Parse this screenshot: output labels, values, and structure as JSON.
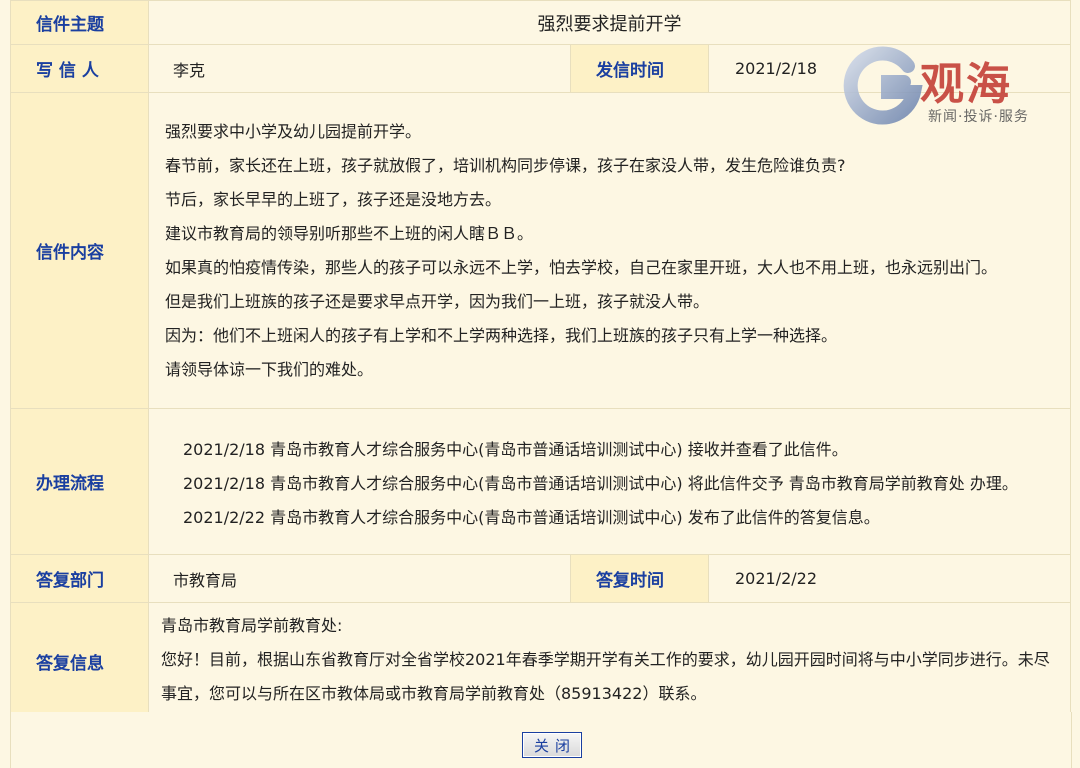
{
  "labels": {
    "subject": "信件主题",
    "writer": "写 信 人",
    "send_time": "发信时间",
    "content": "信件内容",
    "flow": "办理流程",
    "reply_dept": "答复部门",
    "reply_time": "答复时间",
    "reply_info": "答复信息"
  },
  "letter": {
    "subject": "强烈要求提前开学",
    "writer": "李克",
    "send_time": "2021/2/18",
    "content": [
      "强烈要求中小学及幼儿园提前开学。",
      "春节前，家长还在上班，孩子就放假了，培训机构同步停课，孩子在家没人带，发生危险谁负责?",
      "节后，家长早早的上班了，孩子还是没地方去。",
      "建议市教育局的领导别听那些不上班的闲人瞎ＢＢ。",
      "如果真的怕疫情传染，那些人的孩子可以永远不上学，怕去学校，自己在家里开班，大人也不用上班，也永远别出门。",
      "但是我们上班族的孩子还是要求早点开学，因为我们一上班，孩子就没人带。",
      "因为：他们不上班闲人的孩子有上学和不上学两种选择，我们上班族的孩子只有上学一种选择。",
      "请领导体谅一下我们的难处。"
    ]
  },
  "flow": [
    "2021/2/18  青岛市教育人才综合服务中心(青岛市普通话培训测试中心)  接收并查看了此信件。",
    "2021/2/18  青岛市教育人才综合服务中心(青岛市普通话培训测试中心)  将此信件交予  青岛市教育局学前教育处  办理。",
    "2021/2/22  青岛市教育人才综合服务中心(青岛市普通话培训测试中心)  发布了此信件的答复信息。"
  ],
  "reply": {
    "dept": "市教育局",
    "time": "2021/2/22",
    "info": [
      "青岛市教育局学前教育处:",
      "您好！目前，根据山东省教育厅对全省学校2021年春季学期开学有关工作的要求，幼儿园开园时间将与中小学同步进行。未尽事宜，您可以与所在区市教体局或市教育局学前教育处（85913422）联系。"
    ]
  },
  "buttons": {
    "close": "关闭"
  },
  "watermark": {
    "logo_text": "观海",
    "tagline": "新闻·投诉·服务",
    "icon": "g-logo-icon"
  },
  "colors": {
    "label_blue": "#1a3fa0",
    "label_bg": "#fdf1c6",
    "page_bg": "#fdf7e3",
    "watermark_red": "#c23b32"
  }
}
